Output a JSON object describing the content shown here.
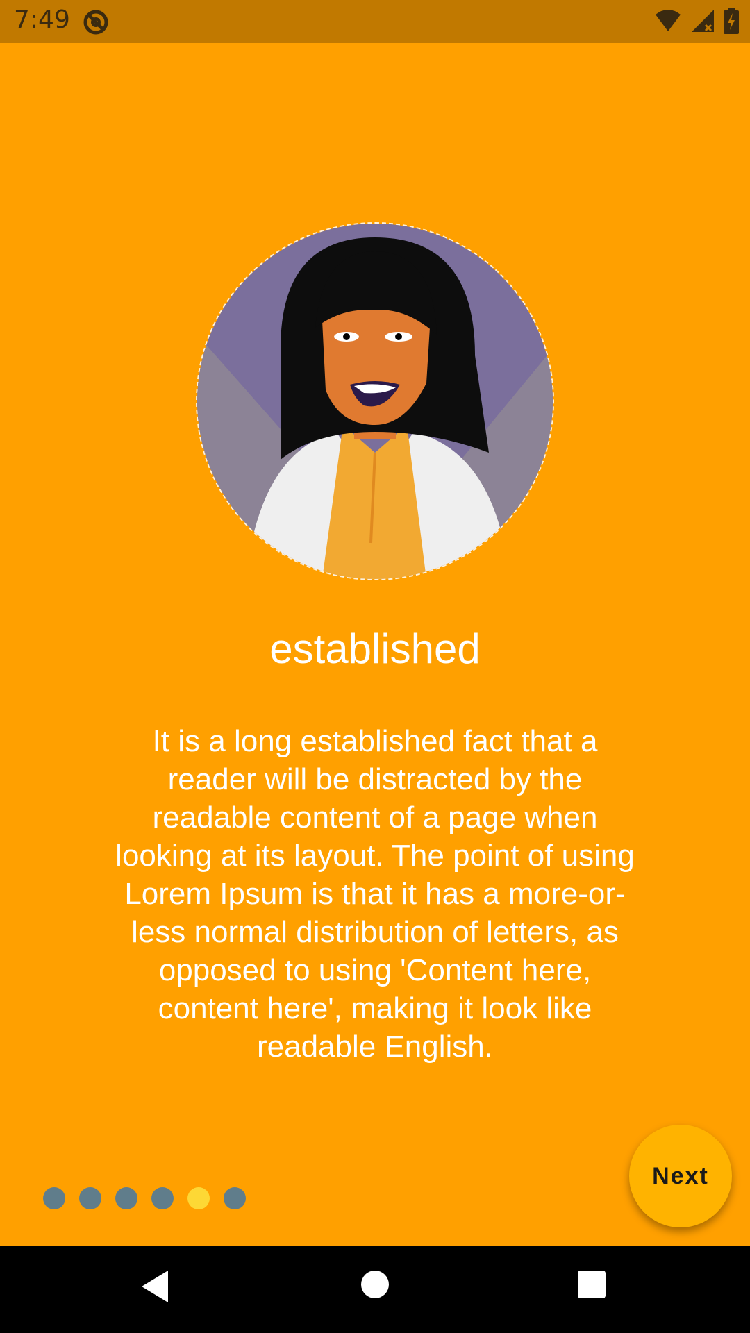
{
  "status_bar": {
    "time": "7:49",
    "icons": [
      "app-notification-icon",
      "wifi-icon",
      "cell-signal-icon",
      "battery-charging-icon"
    ]
  },
  "colors": {
    "background": "#FFA000",
    "status_bar": "#C17900",
    "dot_inactive": "#607D8B",
    "dot_active": "#FDD835",
    "next_button": "#FFB300"
  },
  "onboarding": {
    "title": "established",
    "body": "It is a long established fact that a reader will be distracted by the readable content of a page when looking at its layout. The point of using Lorem Ipsum is that it has a more-or-less normal distribution of letters, as opposed to using 'Content here, content here', making it look like readable English.",
    "page_count": 6,
    "active_page": 5,
    "next_label": "Next"
  },
  "nav_bar": {
    "icons": [
      "back-icon",
      "home-icon",
      "recents-icon"
    ]
  }
}
